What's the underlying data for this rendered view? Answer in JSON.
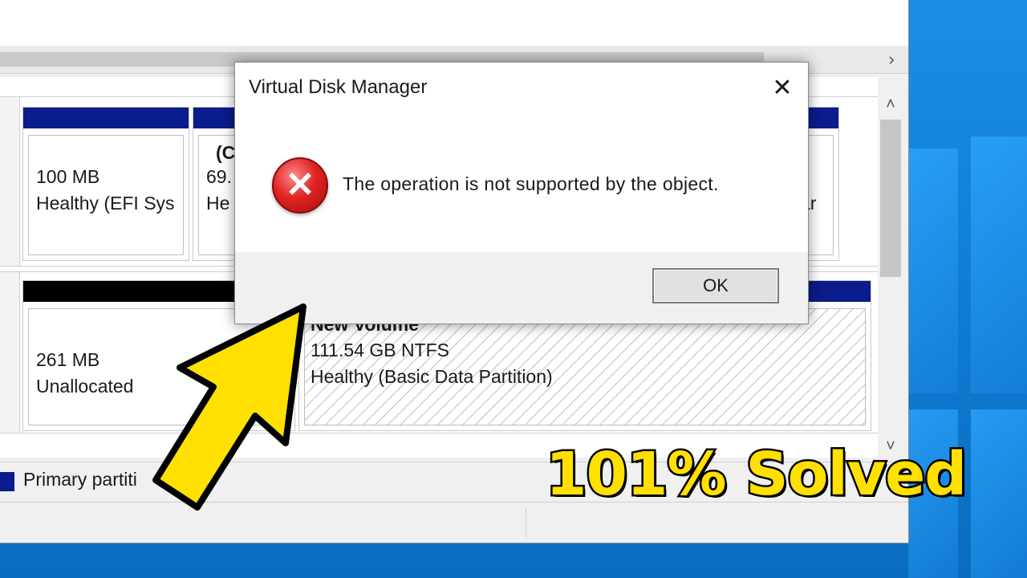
{
  "dialog": {
    "title": "Virtual Disk Manager",
    "close_glyph": "✕",
    "message": "The operation is not supported by the object.",
    "ok_label": "OK",
    "icon": "error-icon"
  },
  "disk_top": {
    "partitions": [
      {
        "line1": "",
        "line2": "100 MB",
        "line3": "Healthy (EFI Sys"
      },
      {
        "line1": "(C",
        "line2": "69.",
        "line3": "He"
      },
      {
        "line1": "",
        "line2": "",
        "line3": "ar"
      }
    ]
  },
  "disk_bottom": {
    "partitions": [
      {
        "line1": "",
        "line2": "261 MB",
        "line3": "Unallocated"
      },
      {
        "line1": "New Volume",
        "line2": "111.54 GB NTFS",
        "line3": "Healthy (Basic Data Partition)"
      }
    ]
  },
  "legend": {
    "primary_label": "Primary partiti",
    "primary_color": "#0b1c8c"
  },
  "overlay": {
    "headline": "101% Solved",
    "headline_color": "#ffe000",
    "arrow_color": "#ffe000"
  },
  "scroll": {
    "right_arrow": "›",
    "up_arrow": "˄",
    "down_arrow": "˅"
  }
}
